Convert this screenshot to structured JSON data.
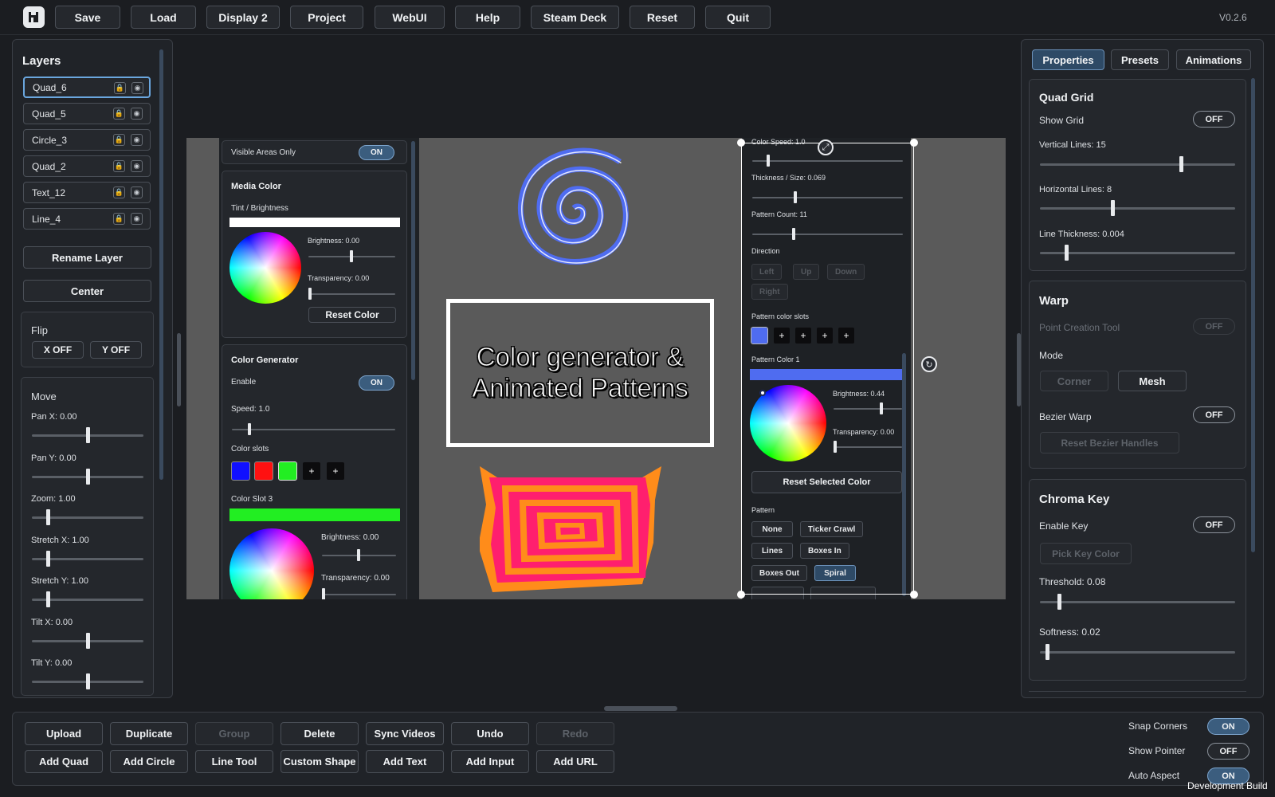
{
  "topbar": {
    "buttons": [
      "Save",
      "Load",
      "Display 2",
      "Project",
      "WebUI",
      "Help",
      "Steam Deck",
      "Reset",
      "Quit"
    ],
    "version": "V0.2.6"
  },
  "layers": {
    "title": "Layers",
    "items": [
      "Quad_6",
      "Quad_5",
      "Circle_3",
      "Quad_2",
      "Text_12",
      "Line_4"
    ],
    "rename": "Rename Layer",
    "center": "Center",
    "flip": {
      "title": "Flip",
      "x": "X OFF",
      "y": "Y OFF"
    },
    "move": {
      "title": "Move",
      "sliders": [
        {
          "label": "Pan X: 0.00",
          "value": 0.5
        },
        {
          "label": "Pan Y: 0.00",
          "value": 0.5
        },
        {
          "label": "Zoom: 1.00",
          "value": 0.13
        },
        {
          "label": "Stretch X: 1.00",
          "value": 0.13
        },
        {
          "label": "Stretch Y: 1.00",
          "value": 0.13
        },
        {
          "label": "Tilt X: 0.00",
          "value": 0.5
        },
        {
          "label": "Tilt Y: 0.00",
          "value": 0.5
        }
      ]
    }
  },
  "canvas": {
    "text_line1": "Color generator &",
    "text_line2": "Animated Patterns",
    "left_overlay": {
      "visible_areas": "Visible Areas Only",
      "visible_state": "ON",
      "media_color": {
        "title": "Media Color",
        "tint": "Tint / Brightness",
        "brightness": {
          "label": "Brightness: 0.00",
          "value": 0.5
        },
        "transparency": {
          "label": "Transparency: 0.00",
          "value": 0.0
        },
        "reset": "Reset Color"
      },
      "color_generator": {
        "title": "Color Generator",
        "enable": "Enable",
        "enable_state": "ON",
        "speed": {
          "label": "Speed: 1.0",
          "value": 0.1
        },
        "slots_label": "Color slots",
        "slot_colors": [
          "#1010ff",
          "#ff1111",
          "#22ee22"
        ],
        "slot3_label": "Color Slot 3",
        "slot3_color": "#22ee22",
        "brightness": {
          "label": "Brightness: 0.00",
          "value": 0.5
        },
        "transparency": {
          "label": "Transparency: 0.00",
          "value": 0.0
        }
      }
    },
    "right_overlay": {
      "color_speed": {
        "label": "Color Speed: 1.0",
        "value": 0.1
      },
      "thickness": {
        "label": "Thickness / Size: 0.069",
        "value": 0.28
      },
      "pattern_count": {
        "label": "Pattern Count: 11",
        "value": 0.27
      },
      "direction": "Direction",
      "dir_buttons": [
        "Left",
        "Up",
        "Down",
        "Right"
      ],
      "pattern_slots": "Pattern color slots",
      "pattern_color1": "Pattern Color 1",
      "pattern_color1_value": "#4f6cf0",
      "brightness": {
        "label": "Brightness: 0.44",
        "value": 0.72
      },
      "transparency": {
        "label": "Transparency: 0.00",
        "value": 0.0
      },
      "reset_selected": "Reset Selected Color",
      "pattern": "Pattern",
      "pattern_buttons": [
        "None",
        "Ticker Crawl",
        "Lines",
        "Boxes In",
        "Boxes Out",
        "Spiral"
      ],
      "selected_pattern": "Spiral"
    }
  },
  "right_panel": {
    "tabs": [
      "Properties",
      "Presets",
      "Animations"
    ],
    "active_tab": "Properties",
    "quad_grid": {
      "title": "Quad Grid",
      "show_grid": "Show Grid",
      "show_grid_state": "OFF",
      "vertical": {
        "label": "Vertical Lines: 15",
        "value": 0.73
      },
      "horizontal": {
        "label": "Horizontal Lines: 8",
        "value": 0.37
      },
      "thickness": {
        "label": "Line Thickness: 0.004",
        "value": 0.13
      }
    },
    "warp": {
      "title": "Warp",
      "point_tool": "Point Creation Tool",
      "point_tool_state": "OFF",
      "mode": "Mode",
      "corner": "Corner",
      "mesh": "Mesh",
      "bezier": "Bezier Warp",
      "bezier_state": "OFF",
      "reset_bezier": "Reset Bezier Handles"
    },
    "chroma": {
      "title": "Chroma Key",
      "enable": "Enable Key",
      "enable_state": "OFF",
      "pick": "Pick Key Color",
      "threshold": {
        "label": "Threshold: 0.08",
        "value": 0.09
      },
      "softness": {
        "label": "Softness: 0.02",
        "value": 0.03
      }
    }
  },
  "bottom": {
    "row1": [
      "Upload",
      "Duplicate",
      "Group",
      "Delete",
      "Sync Videos",
      "Undo",
      "Redo"
    ],
    "row2": [
      "Add Quad",
      "Add Circle",
      "Line Tool",
      "Custom Shape",
      "Add Text",
      "Add Input",
      "Add URL"
    ],
    "toggles": [
      {
        "label": "Snap Corners",
        "state": "ON"
      },
      {
        "label": "Show Pointer",
        "state": "OFF"
      },
      {
        "label": "Auto Aspect",
        "state": "ON"
      }
    ],
    "build": "Development Build"
  },
  "colors": {
    "accent": "#6aa6de",
    "toggle_on": "#3b5d7e",
    "canvas_bg": "#5a5a5a",
    "spiral": "#4f6cf0",
    "square_pink": "#ff1f6e",
    "square_orange": "#ff8c1a"
  }
}
